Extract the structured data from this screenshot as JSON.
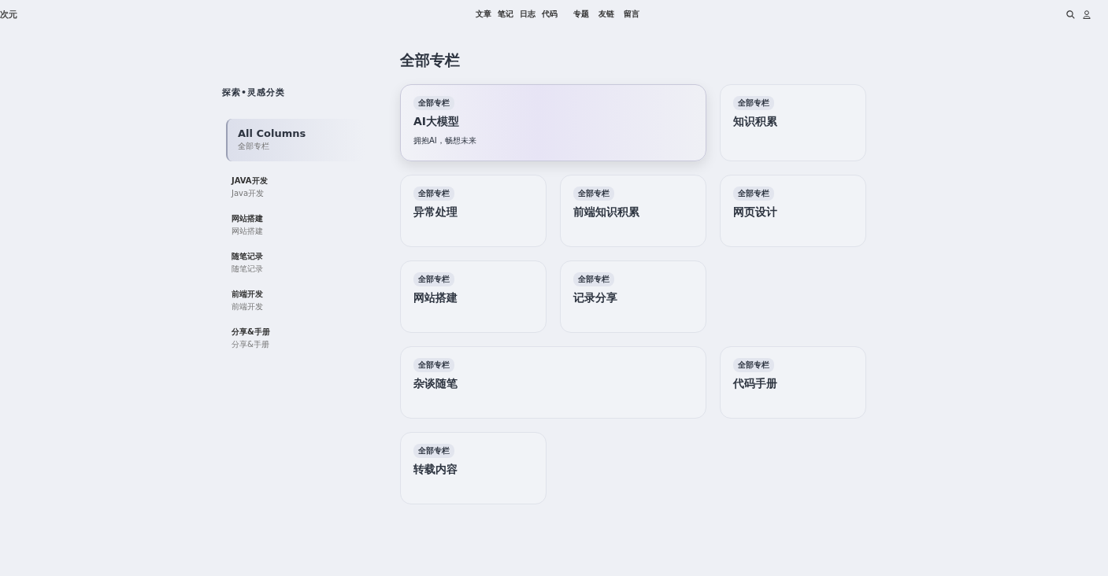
{
  "header": {
    "logo": "次元",
    "nav_groups": [
      [
        "文章",
        "笔记",
        "日志",
        "代码"
      ],
      [
        "专题",
        "友链",
        "留言"
      ]
    ]
  },
  "sidebar": {
    "title": "探索•灵感分类",
    "items": [
      {
        "title": "All Columns",
        "subtitle": "全部专栏",
        "selected": true
      },
      {
        "title": "JAVA开发",
        "subtitle": "Java开发",
        "selected": false
      },
      {
        "title": "网站搭建",
        "subtitle": "网站搭建",
        "selected": false
      },
      {
        "title": "随笔记录",
        "subtitle": "随笔记录",
        "selected": false
      },
      {
        "title": "前端开发",
        "subtitle": "前端开发",
        "selected": false
      },
      {
        "title": "分享&手册",
        "subtitle": "分享&手册",
        "selected": false
      }
    ]
  },
  "main": {
    "title": "全部专栏",
    "cards": [
      {
        "tag": "全部专栏",
        "title": "AI大模型",
        "description": "拥抱AI，畅想未来",
        "wide": true,
        "highlighted": true
      },
      {
        "tag": "全部专栏",
        "title": "知识积累",
        "wide": false,
        "highlighted": false
      },
      {
        "tag": "全部专栏",
        "title": "异常处理",
        "wide": false,
        "highlighted": false
      },
      {
        "tag": "全部专栏",
        "title": "前端知识积累",
        "wide": false,
        "highlighted": false
      },
      {
        "tag": "全部专栏",
        "title": "网页设计",
        "wide": false,
        "highlighted": false
      },
      {
        "tag": "全部专栏",
        "title": "网站搭建",
        "wide": false,
        "highlighted": false
      },
      {
        "tag": "全部专栏",
        "title": "记录分享",
        "wide": false,
        "highlighted": false
      },
      {
        "tag": "全部专栏",
        "title": "杂谈随笔",
        "wide": true,
        "highlighted": false
      },
      {
        "tag": "全部专栏",
        "title": "代码手册",
        "wide": false,
        "highlighted": false
      },
      {
        "tag": "全部专栏",
        "title": "转载内容",
        "wide": false,
        "highlighted": false
      }
    ]
  }
}
